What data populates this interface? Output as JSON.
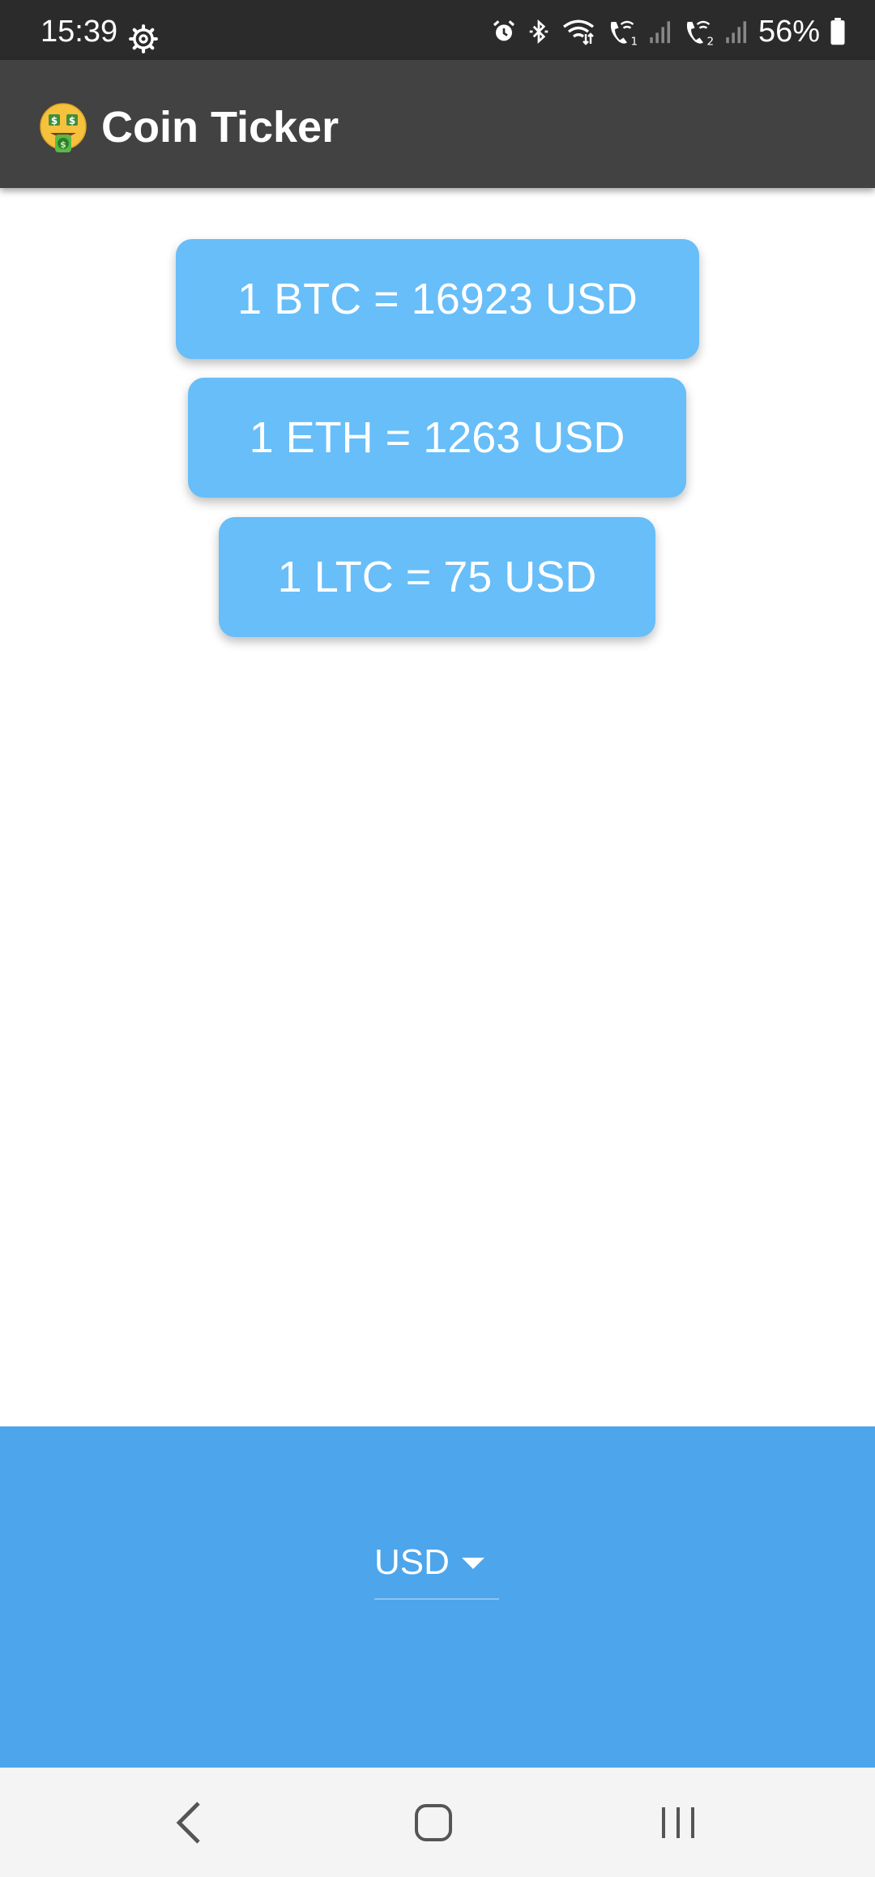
{
  "status_bar": {
    "time": "15:39",
    "battery": "56%",
    "icons": [
      "settings-gear-icon",
      "alarm-icon",
      "bluetooth-icon",
      "wifi-icon",
      "wifi-call-sim1-icon",
      "signal-sim1-icon",
      "wifi-call-sim2-icon",
      "signal-sim2-icon",
      "battery-icon"
    ]
  },
  "app_bar": {
    "emoji_icon": "money-mouth-face-icon",
    "title": "Coin Ticker",
    "background": "#424242"
  },
  "rates": [
    {
      "text": "1 BTC = 16923 USD",
      "coin": "BTC",
      "value": 16923,
      "currency": "USD"
    },
    {
      "text": "1 ETH = 1263 USD",
      "coin": "ETH",
      "value": 1263,
      "currency": "USD"
    },
    {
      "text": "1 LTC = 75 USD",
      "coin": "LTC",
      "value": 75,
      "currency": "USD"
    }
  ],
  "currency_picker": {
    "selected": "USD",
    "background": "#4da5eb"
  },
  "colors": {
    "card": "#67bef9",
    "status_bar": "#2b2b2b"
  },
  "nav_bar": {
    "buttons": [
      "back-icon",
      "home-icon",
      "recent-apps-icon"
    ]
  }
}
